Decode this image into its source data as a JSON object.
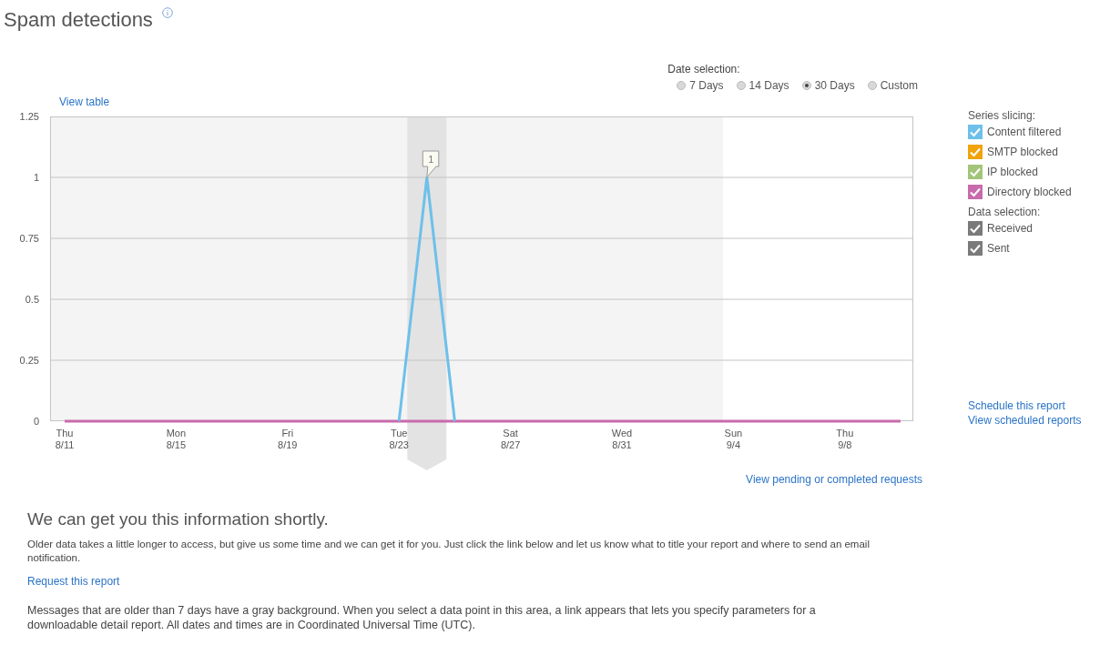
{
  "page": {
    "title": "Spam detections"
  },
  "date_selection": {
    "label": "Date selection:",
    "options": [
      {
        "label": "7 Days",
        "selected": false
      },
      {
        "label": "14 Days",
        "selected": false
      },
      {
        "label": "30 Days",
        "selected": true
      },
      {
        "label": "Custom",
        "selected": false
      }
    ]
  },
  "view_table_link": "View table",
  "chart": {
    "chart_data": {
      "type": "line",
      "categories": [
        "Thu\n8/11",
        null,
        null,
        null,
        "Mon\n8/15",
        null,
        null,
        null,
        "Fri\n8/19",
        null,
        null,
        null,
        "Tue\n8/23",
        null,
        null,
        null,
        "Sat\n8/27",
        null,
        null,
        null,
        "Wed\n8/31",
        null,
        null,
        null,
        "Sun\n9/4",
        null,
        null,
        null,
        "Thu\n9/8",
        null,
        null
      ],
      "series": [
        {
          "color": "#c86bac",
          "values": [
            0,
            0,
            0,
            0,
            0,
            0,
            0,
            0,
            0,
            0,
            0,
            0,
            0,
            0,
            0,
            0,
            0,
            0,
            0,
            0,
            0,
            0,
            0,
            0,
            0,
            0,
            0,
            0,
            0,
            0,
            0
          ]
        },
        {
          "color": "#6dc0ea",
          "values": [
            null,
            null,
            null,
            null,
            null,
            null,
            null,
            null,
            null,
            null,
            null,
            null,
            0,
            1,
            0,
            null,
            null,
            null,
            null,
            null,
            null,
            null,
            null,
            null,
            null,
            null,
            null,
            null,
            null,
            null,
            null
          ]
        }
      ],
      "ylim": [
        0,
        1.25
      ],
      "yticks": [
        0,
        0.25,
        0.5,
        0.75,
        1,
        1.25
      ],
      "grid": true,
      "annotations": [
        {
          "y": 1,
          "text": "1"
        }
      ]
    }
  },
  "series_slicing": {
    "label": "Series slicing:",
    "items": [
      {
        "label": "Content filtered",
        "checked": true,
        "color": "#6dc0ea"
      },
      {
        "label": "SMTP blocked",
        "checked": true,
        "color": "#f0a30a"
      },
      {
        "label": "IP blocked",
        "checked": true,
        "color": "#a2c579"
      },
      {
        "label": "Directory blocked",
        "checked": true,
        "color": "#c86bac"
      }
    ]
  },
  "data_selection": {
    "label": "Data selection:",
    "items": [
      {
        "label": "Received",
        "checked": true
      },
      {
        "label": "Sent",
        "checked": true
      }
    ]
  },
  "report_links": [
    "Schedule this report",
    "View scheduled reports"
  ],
  "pending_link": "View pending or completed requests",
  "info": {
    "heading": "We can get you this information shortly.",
    "body": "Older data takes a little longer to access, but give us some time and we can get it for you. Just click the link below and let us know what to title your report and where to send an email notification.",
    "link": "Request this report",
    "note": "Messages that are older than 7 days have a gray background. When you select a data point in this area, a link appears that lets you specify parameters for a downloadable detail report. All dates and times are in Coordinated Universal Time (UTC)."
  }
}
